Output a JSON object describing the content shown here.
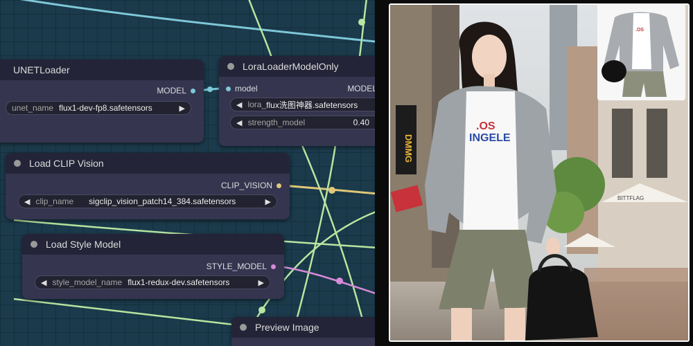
{
  "nodes": {
    "unet_loader": {
      "title": "UNETLoader",
      "output": "MODEL",
      "unet_name": {
        "label": "unet_name",
        "value": "flux1-dev-fp8.safetensors"
      }
    },
    "lora_loader": {
      "title": "LoraLoaderModelOnly",
      "input": "model",
      "output": "MODEL",
      "lora_name": {
        "label": "lora_",
        "value": "flux洗图神器.safetensors"
      },
      "strength_model": {
        "label": "strength_model",
        "value": "0.40"
      }
    },
    "load_clip_vision": {
      "title": "Load CLIP Vision",
      "output": "CLIP_VISION",
      "clip_name": {
        "label": "clip_name",
        "value": "sigclip_vision_patch14_384.safetensors"
      }
    },
    "load_style_model": {
      "title": "Load Style Model",
      "output": "STYLE_MODEL",
      "style_model_name": {
        "label": "style_model_name",
        "value": "flux1-redux-dev.safetensors"
      }
    },
    "preview_image": {
      "title": "Preview Image"
    }
  },
  "colors": {
    "canvas_bg": "#1b3a4b",
    "node_body": "#353550",
    "node_header": "#242438",
    "wire_model": "#7ec8d8",
    "wire_green": "#b9e5a0",
    "wire_clip_vision": "#e0c77a",
    "wire_style": "#d68ad8"
  },
  "photo": {
    "shirt_text_line1": ".OS",
    "shirt_text_line2": "INGELE",
    "shop_sign": "BITTFLAG",
    "vertical_sign": "DMMG"
  }
}
